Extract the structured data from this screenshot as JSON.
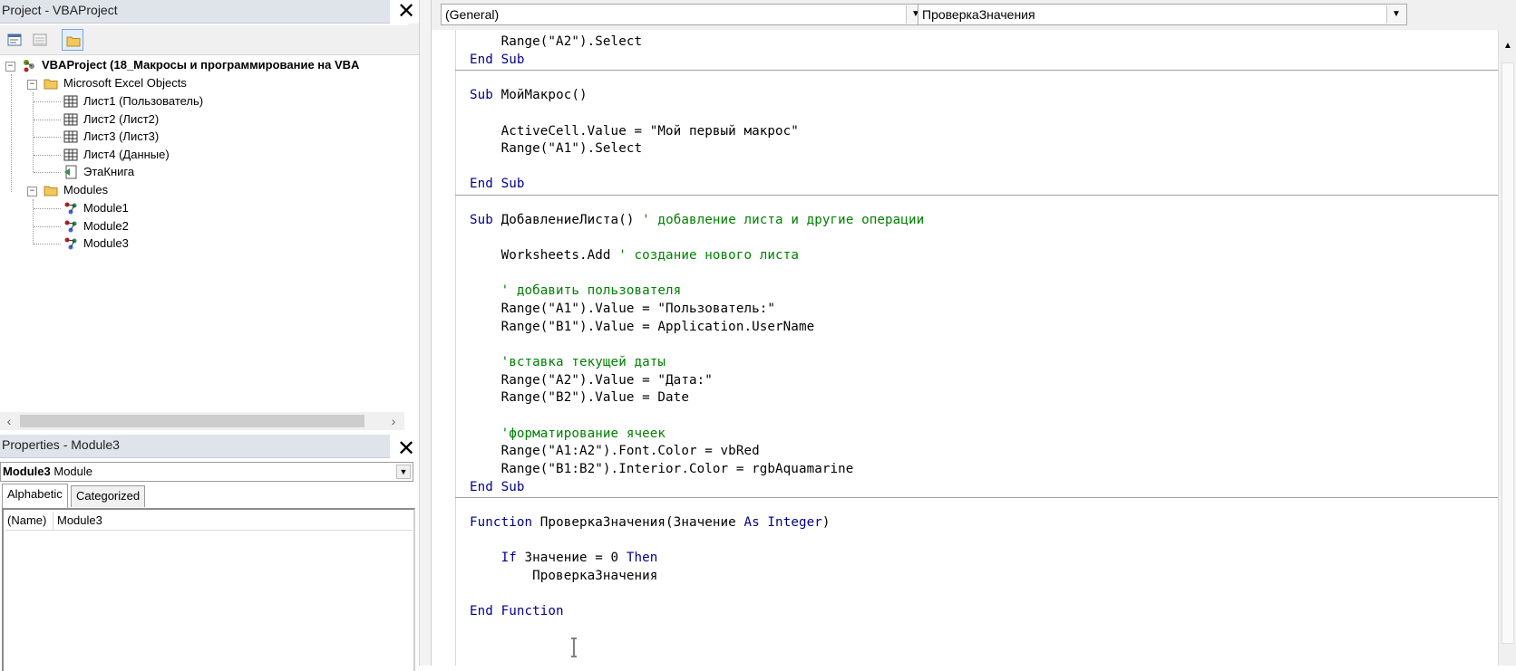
{
  "project": {
    "title": "Project - VBAProject",
    "close_glyph": "✕",
    "root_label": "VBAProject (18_Макросы и программирование на VBA",
    "excel_objects_label": "Microsoft Excel Objects",
    "sheets": [
      {
        "label": "Лист1 (Пользователь)"
      },
      {
        "label": "Лист2 (Лист2)"
      },
      {
        "label": "Лист3 (Лист3)"
      },
      {
        "label": "Лист4 (Данные)"
      },
      {
        "label": "ЭтаКнига"
      }
    ],
    "modules_label": "Modules",
    "modules": [
      {
        "label": "Module1"
      },
      {
        "label": "Module2"
      },
      {
        "label": "Module3"
      }
    ],
    "toolbar_icons": [
      "view-code-icon",
      "view-object-icon",
      "toggle-folders-icon"
    ]
  },
  "properties": {
    "title": "Properties - Module3",
    "close_glyph": "✕",
    "object_name": "Module3",
    "object_type": "Module",
    "tabs": [
      {
        "label": "Alphabetic"
      },
      {
        "label": "Categorized"
      }
    ],
    "rows": [
      {
        "key": "(Name)",
        "value": "Module3"
      }
    ]
  },
  "code_header": {
    "object_combo": "(General)",
    "procedure_combo": "ПроверкаЗначения"
  },
  "code": {
    "lines": [
      "    Range(\"A2\").Select",
      "End Sub",
      "Sub МойМакрос()",
      "    ActiveCell.Value = \"Мой первый макрос\"",
      "    Range(\"A1\").Select",
      "End Sub",
      "Sub ДобавлениеЛиста()",
      " ' добавление листа и другие операции",
      "    Worksheets.Add",
      " ' создание нового листа",
      "    ' добавить пользователя",
      "    Range(\"A1\").Value = \"Пользователь:\"",
      "    Range(\"B1\").Value = Application.UserName",
      "    'вставка текущей даты",
      "    Range(\"A2\").Value = \"Дата:\"",
      "    Range(\"B2\").Value = Date",
      "    'форматирование ячеек",
      "    Range(\"A1:A2\").Font.Color = vbRed",
      "    Range(\"B1:B2\").Interior.Color = rgbAquamarine",
      "End Sub",
      "Function",
      " ПроверкаЗначения(Значение ",
      "As",
      " Integer",
      ")",
      "    If",
      " Значение = 0 ",
      "Then",
      "        ПроверкаЗначения",
      "End Function"
    ]
  },
  "colors": {
    "keyword": "#00008b",
    "comment": "#008000",
    "pane_title_bg": "#dfe3ea"
  }
}
